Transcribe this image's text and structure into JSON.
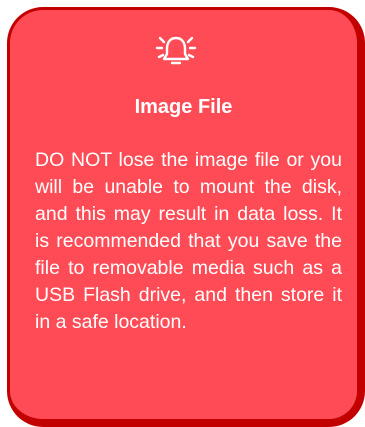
{
  "note": {
    "icon": "bell-alert-icon",
    "title": "Image File",
    "body": "DO NOT lose the image file or you will be unable to mount the disk, and this may result in data loss. It is recommend­ed that you save the file to re­movable media such as a USB Flash drive, and then store it in a safe location."
  },
  "colors": {
    "card_fill": "#fe4b55",
    "card_border": "#c20000",
    "text": "#ffffff"
  }
}
